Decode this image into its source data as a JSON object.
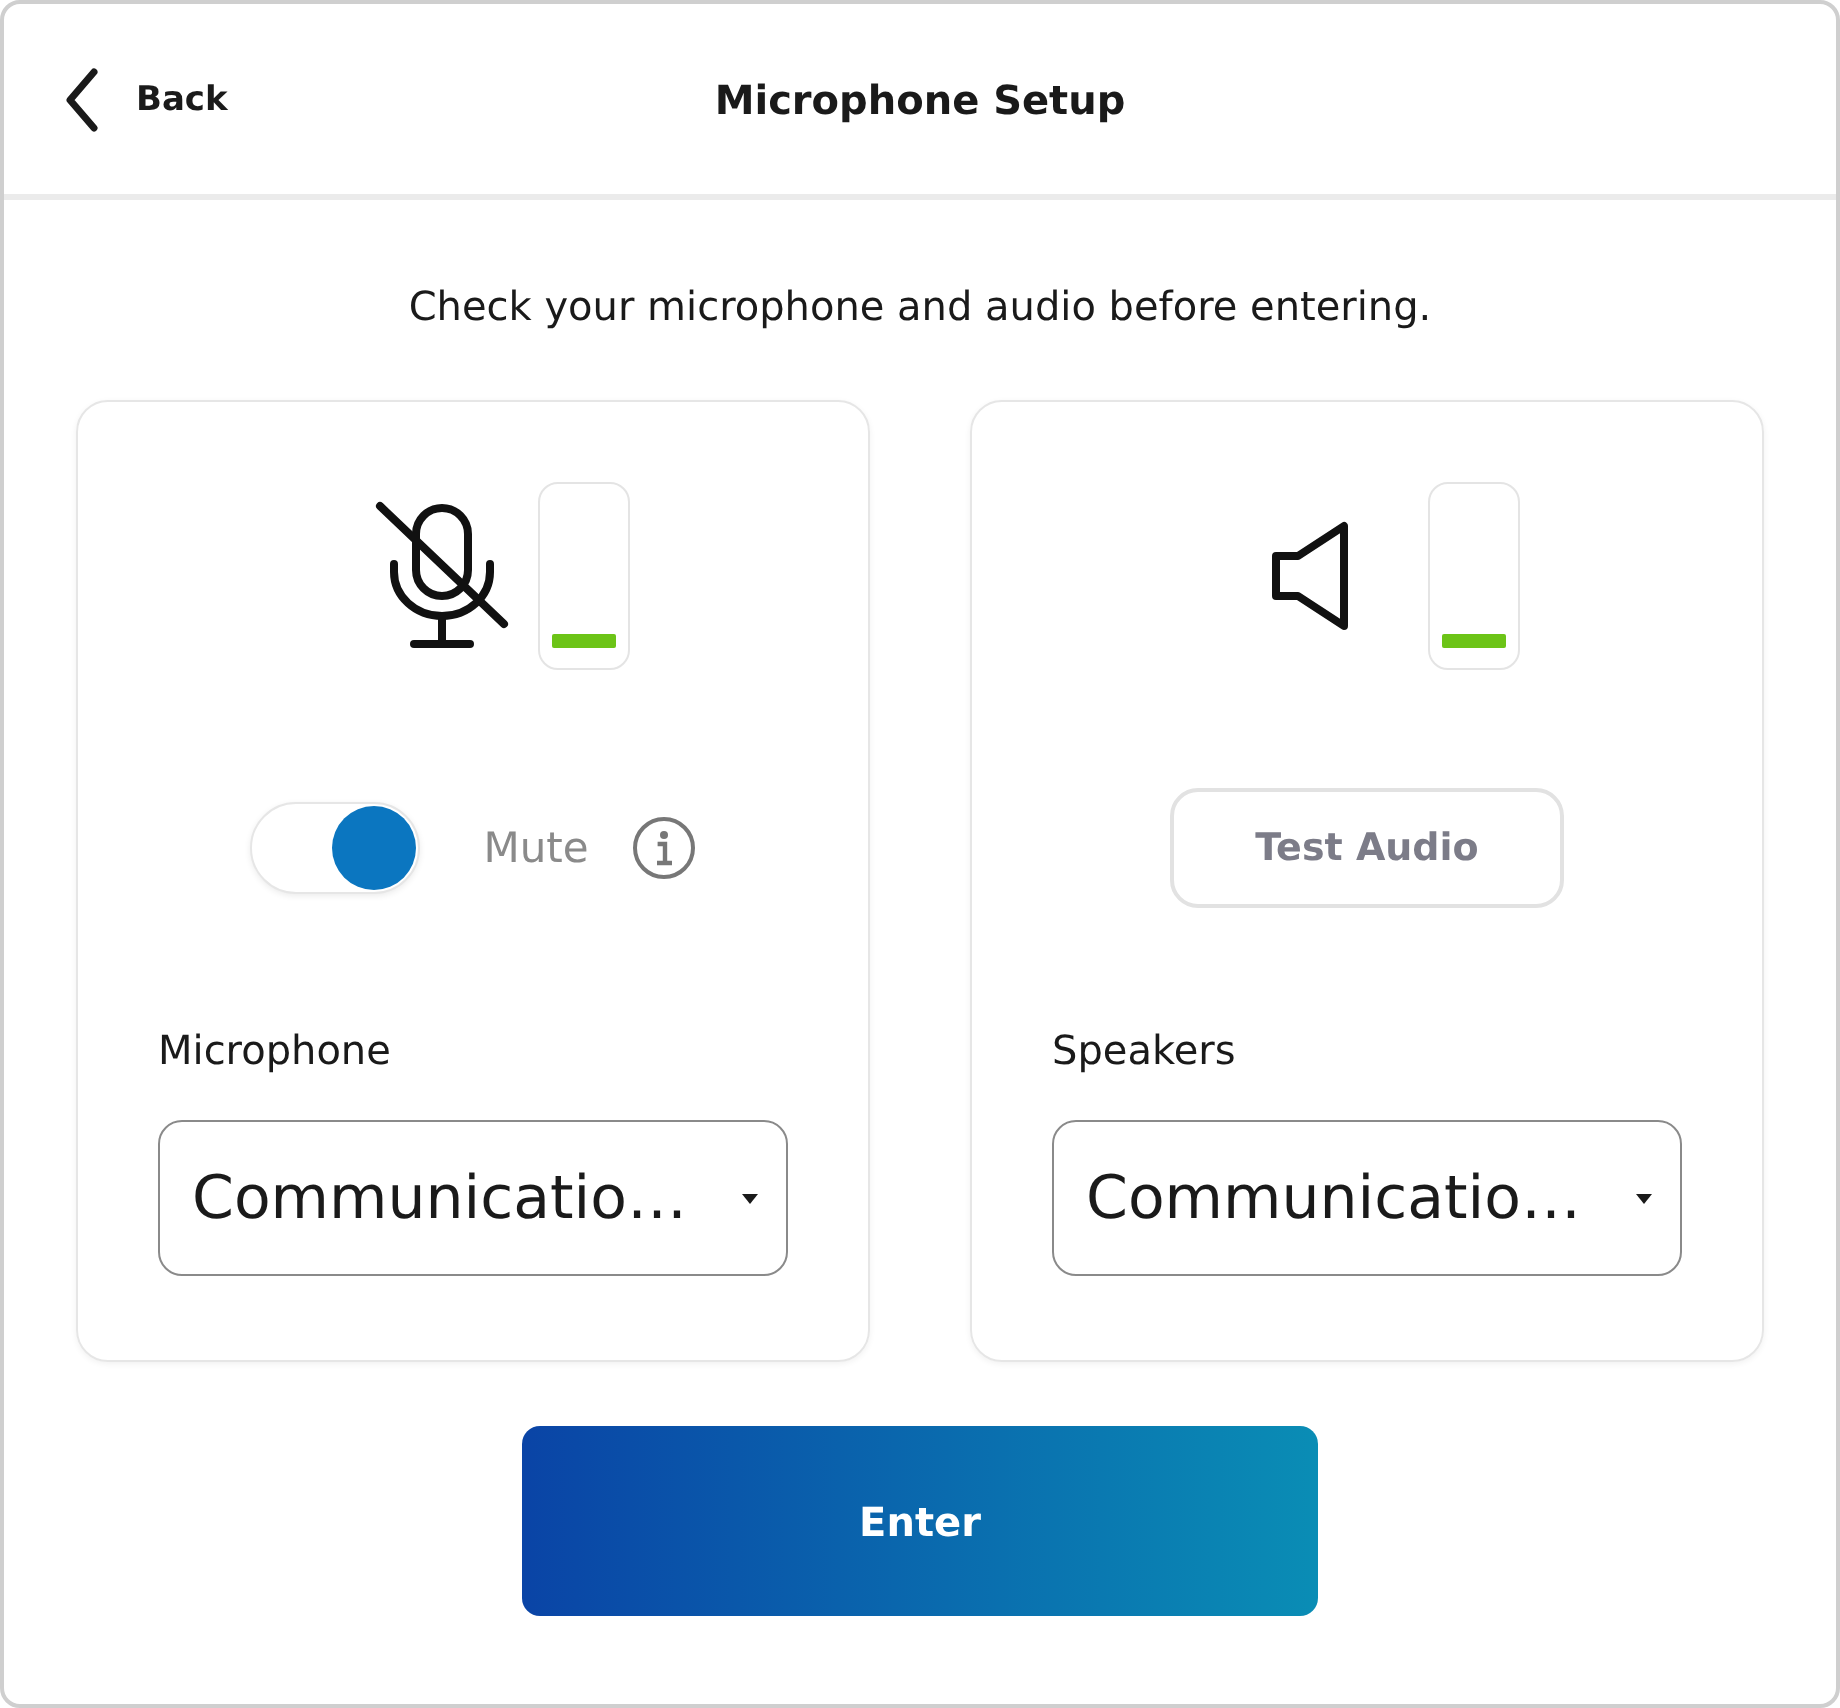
{
  "header": {
    "back_label": "Back",
    "title": "Microphone Setup"
  },
  "instruction": "Check your microphone and audio before entering.",
  "panels": [
    {
      "kind": "microphone",
      "level": 0.1,
      "toggle": {
        "label": "Mute",
        "on": true
      },
      "device_label": "Microphone",
      "device": "Communicatio…"
    },
    {
      "kind": "speakers",
      "level": 0.1,
      "button": "Test Audio",
      "device_label": "Speakers",
      "device": "Communicatio…"
    }
  ],
  "enter_button": "Enter"
}
